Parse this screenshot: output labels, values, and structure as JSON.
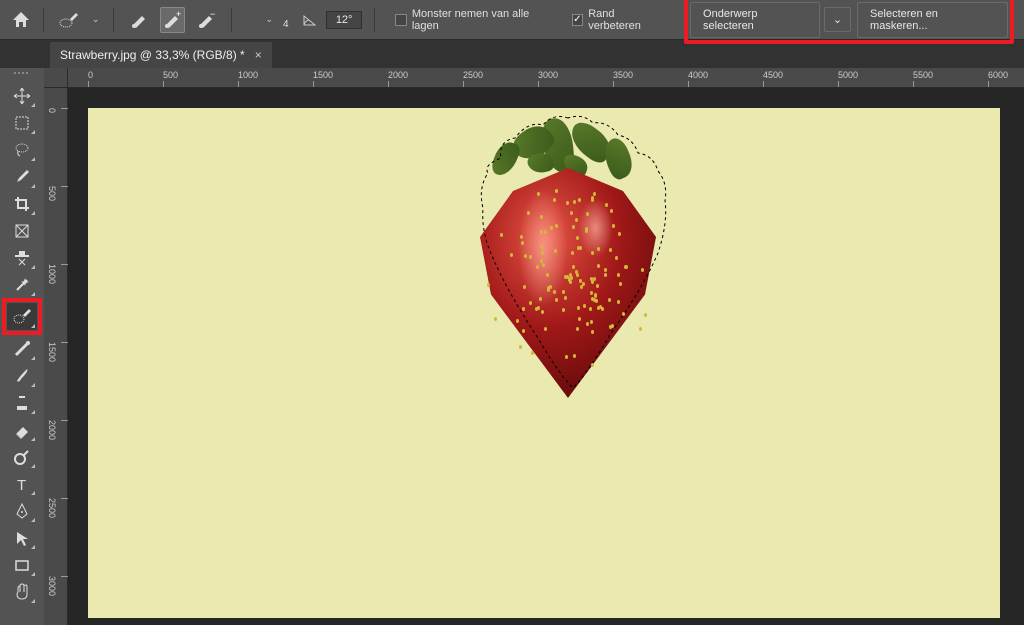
{
  "optionsBar": {
    "angleValue": "12°",
    "brushSize": "4",
    "sampleAllLayers": "Monster nemen van alle lagen",
    "enhanceEdge": "Rand verbeteren",
    "enhanceEdgeChecked": true,
    "selectSubject": "Onderwerp selecteren",
    "selectAndMask": "Selecteren en maskeren..."
  },
  "tab": {
    "title": "Strawberry.jpg @ 33,3% (RGB/8) *"
  },
  "rulerH": [
    "0",
    "500",
    "1000",
    "1500",
    "2000",
    "2500",
    "3000",
    "3500",
    "4000",
    "4500",
    "5000",
    "5500",
    "6000"
  ],
  "rulerV": [
    "0",
    "500",
    "1000",
    "1500",
    "2000",
    "2500",
    "3000"
  ]
}
